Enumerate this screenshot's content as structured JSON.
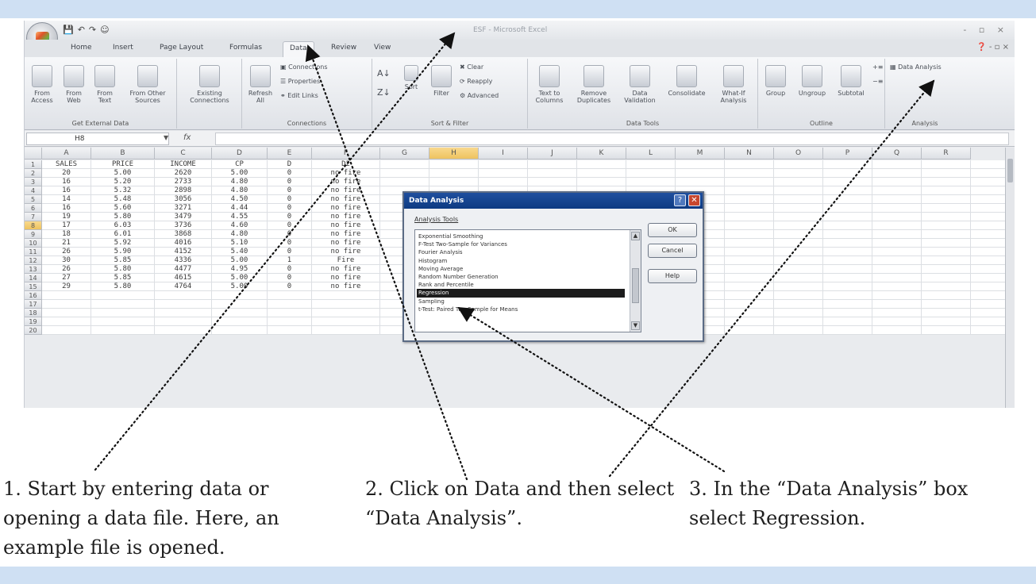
{
  "window": {
    "title": "ESF - Microsoft Excel",
    "quick_access": [
      "💾",
      "↶",
      "↷",
      "☺"
    ],
    "controls": "- ▫ ×"
  },
  "tabs": [
    {
      "label": "Home"
    },
    {
      "label": "Insert"
    },
    {
      "label": "Page Layout"
    },
    {
      "label": "Formulas"
    },
    {
      "label": "Data",
      "active": true
    },
    {
      "label": "Review"
    },
    {
      "label": "View"
    }
  ],
  "ribbon": {
    "get_external_data": {
      "label": "Get External Data",
      "buttons": [
        "From Access",
        "From Web",
        "From Text",
        "From Other Sources"
      ]
    },
    "existing_connections": "Existing Connections",
    "connections": {
      "label": "Connections",
      "refresh": "Refresh All",
      "items": [
        "Connections",
        "Properties",
        "Edit Links"
      ]
    },
    "sort_filter": {
      "label": "Sort & Filter",
      "sort": "Sort",
      "filter": "Filter",
      "items": [
        "Clear",
        "Reapply",
        "Advanced"
      ]
    },
    "data_tools": {
      "label": "Data Tools",
      "buttons": [
        "Text to Columns",
        "Remove Duplicates",
        "Data Validation",
        "Consolidate",
        "What-If Analysis"
      ]
    },
    "outline": {
      "label": "Outline",
      "buttons": [
        "Group",
        "Ungroup",
        "Subtotal"
      ]
    },
    "analysis": {
      "label": "Analysis",
      "data_analysis": "Data Analysis"
    }
  },
  "formula_bar": {
    "name_box": "H8",
    "fx": "fx",
    "value": ""
  },
  "sheet": {
    "columns": [
      "A",
      "B",
      "C",
      "D",
      "E",
      "F",
      "G",
      "H",
      "I",
      "J",
      "K",
      "L",
      "M",
      "N",
      "O",
      "P",
      "Q",
      "R"
    ],
    "selected_column": "H",
    "selected_row": "8",
    "rows": [
      {
        "n": "1",
        "cells": [
          "SALES",
          "PRICE",
          "INCOME",
          "CP",
          "D",
          "D2"
        ]
      },
      {
        "n": "2",
        "cells": [
          "20",
          "5.00",
          "2620",
          "5.00",
          "0",
          "no fire"
        ]
      },
      {
        "n": "3",
        "cells": [
          "16",
          "5.20",
          "2733",
          "4.80",
          "0",
          "no fire"
        ]
      },
      {
        "n": "4",
        "cells": [
          "16",
          "5.32",
          "2898",
          "4.80",
          "0",
          "no fire"
        ]
      },
      {
        "n": "5",
        "cells": [
          "14",
          "5.48",
          "3056",
          "4.50",
          "0",
          "no fire"
        ]
      },
      {
        "n": "6",
        "cells": [
          "16",
          "5.60",
          "3271",
          "4.44",
          "0",
          "no fire"
        ]
      },
      {
        "n": "7",
        "cells": [
          "19",
          "5.80",
          "3479",
          "4.55",
          "0",
          "no fire"
        ]
      },
      {
        "n": "8",
        "cells": [
          "17",
          "6.03",
          "3736",
          "4.60",
          "0",
          "no fire"
        ]
      },
      {
        "n": "9",
        "cells": [
          "18",
          "6.01",
          "3868",
          "4.80",
          "0",
          "no fire"
        ]
      },
      {
        "n": "10",
        "cells": [
          "21",
          "5.92",
          "4016",
          "5.10",
          "0",
          "no fire"
        ]
      },
      {
        "n": "11",
        "cells": [
          "26",
          "5.90",
          "4152",
          "5.40",
          "0",
          "no fire"
        ]
      },
      {
        "n": "12",
        "cells": [
          "30",
          "5.85",
          "4336",
          "5.00",
          "1",
          "Fire"
        ]
      },
      {
        "n": "13",
        "cells": [
          "26",
          "5.80",
          "4477",
          "4.95",
          "0",
          "no fire"
        ]
      },
      {
        "n": "14",
        "cells": [
          "27",
          "5.85",
          "4615",
          "5.00",
          "0",
          "no fire"
        ]
      },
      {
        "n": "15",
        "cells": [
          "29",
          "5.80",
          "4764",
          "5.00",
          "0",
          "no fire"
        ]
      },
      {
        "n": "16",
        "cells": []
      },
      {
        "n": "17",
        "cells": []
      },
      {
        "n": "18",
        "cells": []
      },
      {
        "n": "19",
        "cells": []
      },
      {
        "n": "20",
        "cells": []
      }
    ]
  },
  "dialog": {
    "title": "Data Analysis",
    "help_glyph": "?",
    "close_glyph": "✕",
    "list_label": "Analysis Tools",
    "tools": [
      "Exponential Smoothing",
      "F-Test Two-Sample for Variances",
      "Fourier Analysis",
      "Histogram",
      "Moving Average",
      "Random Number Generation",
      "Rank and Percentile",
      "Regression",
      "Sampling",
      "t-Test: Paired Two Sample for Means"
    ],
    "selected_tool": "Regression",
    "ok": "OK",
    "cancel": "Cancel",
    "help": "Help"
  },
  "captions": {
    "step1": "1. Start by entering data or opening a data file. Here, an example file is opened.",
    "step2": "2. Click on Data and then select “Data Analysis”.",
    "step3": "3. In the “Data Analysis” box select Regression."
  },
  "colors": {
    "band": "#cfe0f3",
    "dialog_title": "#0d3a82",
    "selection_header": "#eec35f"
  }
}
